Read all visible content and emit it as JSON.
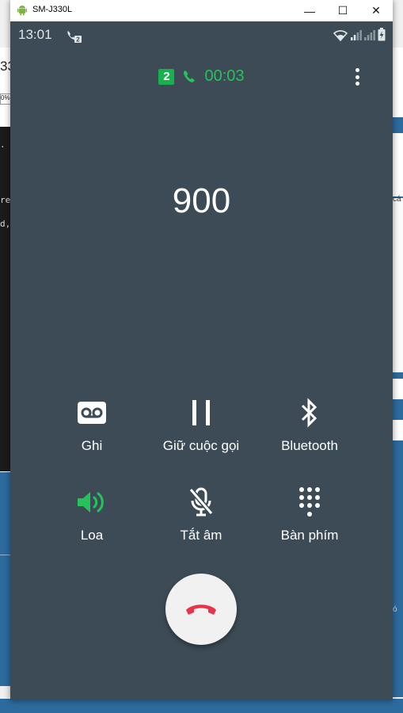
{
  "window": {
    "title": "SM-J330L",
    "minimize_glyph": "—",
    "maximize_glyph": "☐",
    "close_glyph": "✕"
  },
  "status_bar": {
    "time": "13:01",
    "sim_indicator": "2",
    "battery_icon": "battery-charging-icon",
    "wifi_icon": "wifi-icon",
    "signal_icon": "signal-icon"
  },
  "call": {
    "sim_badge": "2",
    "timer": "00:03",
    "number": "900"
  },
  "controls": {
    "record": {
      "label": "Ghi",
      "icon": "voicemail-icon"
    },
    "hold": {
      "label": "Giữ cuộc gọi",
      "icon": "pause-icon"
    },
    "bluetooth": {
      "label": "Bluetooth",
      "icon": "bluetooth-icon"
    },
    "speaker": {
      "label": "Loa",
      "icon": "speaker-icon",
      "active": true
    },
    "mute": {
      "label": "Tắt âm",
      "icon": "mic-off-icon"
    },
    "keypad": {
      "label": "Bàn phím",
      "icon": "dialpad-icon"
    }
  },
  "colors": {
    "screen_bg": "#3c4b55",
    "accent_green": "#27c25c",
    "end_call_red": "#e8334a"
  },
  "background": {
    "left_top_text": "33",
    "left_small_text": "0%)",
    "code_lines": [
      ".",
      "re",
      "d,"
    ],
    "right_text_1": "cá",
    "right_text_2": "ó"
  }
}
